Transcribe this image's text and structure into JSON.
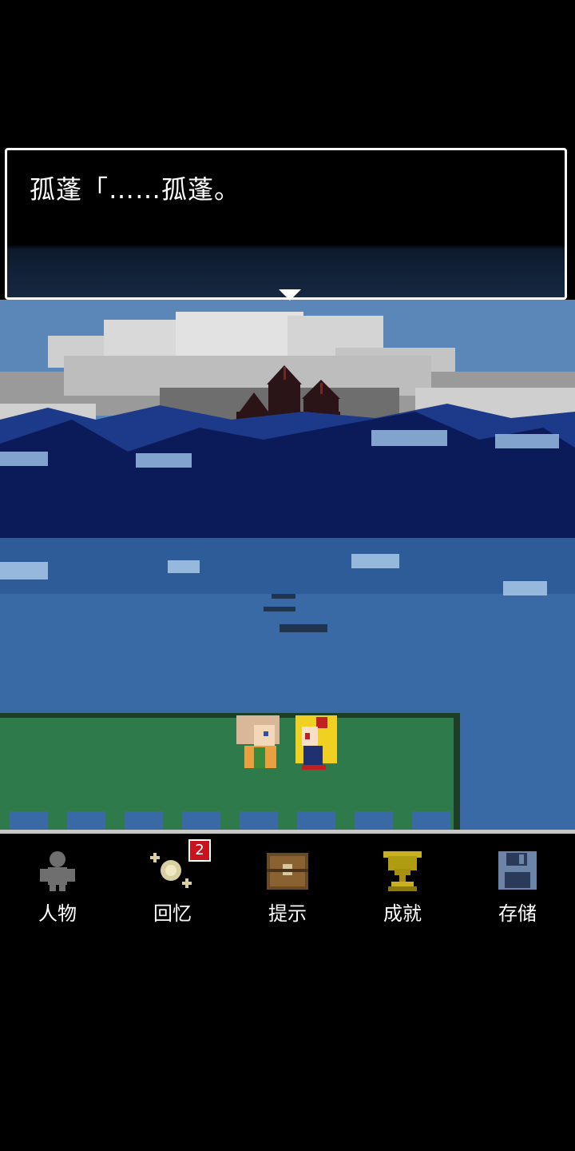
{
  "dialog": {
    "text": "孤蓬「……孤蓬。"
  },
  "menu": {
    "items": [
      {
        "label": "人物",
        "icon": "character-silhouette-icon"
      },
      {
        "label": "回忆",
        "icon": "memory-sparkle-icon"
      },
      {
        "label": "提示",
        "icon": "treasure-chest-icon"
      },
      {
        "label": "成就",
        "icon": "trophy-icon"
      },
      {
        "label": "存储",
        "icon": "floppy-disk-icon"
      }
    ],
    "memory_badge": "2"
  },
  "colors": {
    "sky": "#5b86b8",
    "mountains": "#0b1b5a",
    "sea": "#3a6aa6",
    "grass": "#2f7a4a",
    "badge": "#c8141e"
  }
}
